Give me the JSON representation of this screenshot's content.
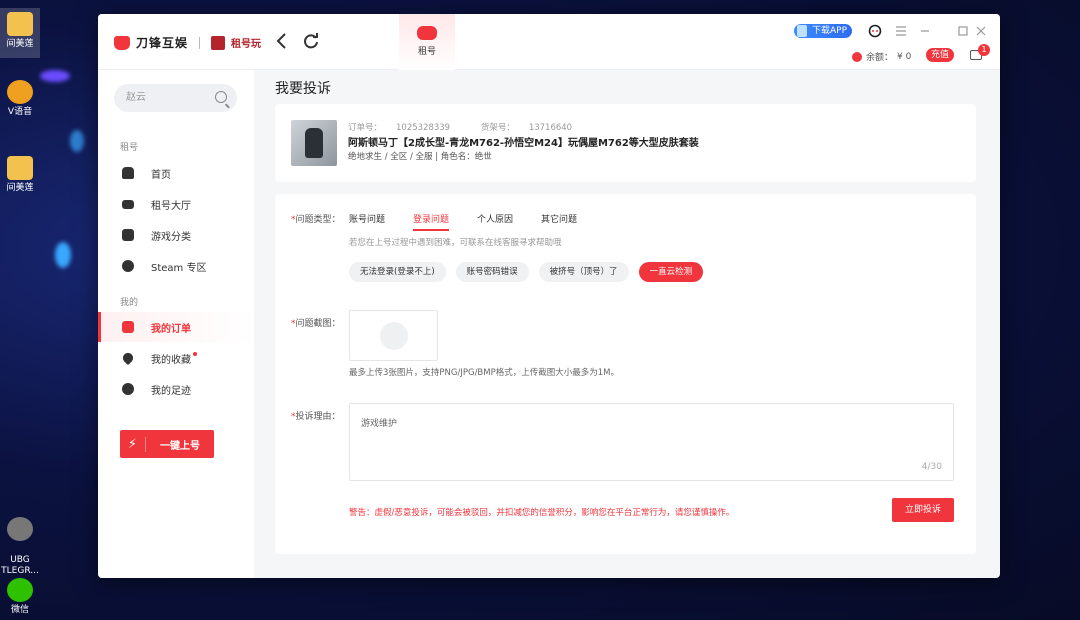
{
  "desktop": {
    "icons": [
      {
        "label": "间美莲",
        "color": "#f2c14e"
      },
      {
        "label": "V语音",
        "color": "#f0a020"
      },
      {
        "label": "间美莲",
        "color": "#f2c14e"
      },
      {
        "label": "UBG\nTLEGR...",
        "color": "#777"
      },
      {
        "label": "微信",
        "color": "#2dc100"
      }
    ]
  },
  "app": {
    "logo_text": "刀锋互娱",
    "logo2_text": "租号玩",
    "nav": {
      "back": "back-icon",
      "refresh": "refresh-icon"
    },
    "active_tab": {
      "label": "租号",
      "icon": "gamepad-icon"
    },
    "download_app": "下载APP",
    "balance": {
      "label": "余额：",
      "value": "¥ 0"
    },
    "recharge": "充值",
    "message_count": "1",
    "colors": {
      "accent": "#f0353d",
      "background": "#f5f6f8"
    }
  },
  "sidebar": {
    "search_text": "赵云",
    "section1_title": "租号",
    "section1_items": [
      {
        "label": "首页",
        "icon": "home-icon"
      },
      {
        "label": "租号大厅",
        "icon": "controller-icon"
      },
      {
        "label": "游戏分类",
        "icon": "category-icon"
      },
      {
        "label": "Steam 专区",
        "icon": "steam-icon"
      }
    ],
    "section2_title": "我的",
    "section2_items": [
      {
        "label": "我的订单",
        "icon": "order-icon",
        "active": true
      },
      {
        "label": "我的收藏",
        "icon": "heart-icon"
      },
      {
        "label": "我的足迹",
        "icon": "clock-icon"
      }
    ],
    "onekey_label": "一键上号"
  },
  "main": {
    "title": "我要投诉",
    "order": {
      "order_no_label": "订单号：",
      "order_no": "1025328339",
      "goods_no_label": "货架号：",
      "goods_no": "13716640",
      "title": "阿斯顿马丁【2成长型-青龙M762-孙悟空M24】玩偶屋M762等大型皮肤套装",
      "sub": "绝地求生 / 全区 / 全服  |  角色名：绝世"
    },
    "form": {
      "type_label": "问题类型：",
      "tabs": [
        "账号问题",
        "登录问题",
        "个人原因",
        "其它问题"
      ],
      "active_tab": "登录问题",
      "hint": "若您在上号过程中遇到困难，可联系在线客服寻求帮助哦",
      "chips": [
        "无法登录(登录不上)",
        "账号密码错误",
        "被挤号（顶号）了",
        "一直云检测"
      ],
      "screenshot_label": "问题截图：",
      "upload_tip": "最多上传3张图片，支持PNG/JPG/BMP格式，上传截图大小最多为1M。",
      "reason_label": "投诉理由：",
      "reason_text": "游戏维护",
      "reason_count": "4/30",
      "warning": "警告：虚假/恶意投诉，可能会被驳回，并扣减您的信誉积分，影响您在平台正常行为，请您谨慎操作。",
      "submit": "立即投诉"
    }
  }
}
